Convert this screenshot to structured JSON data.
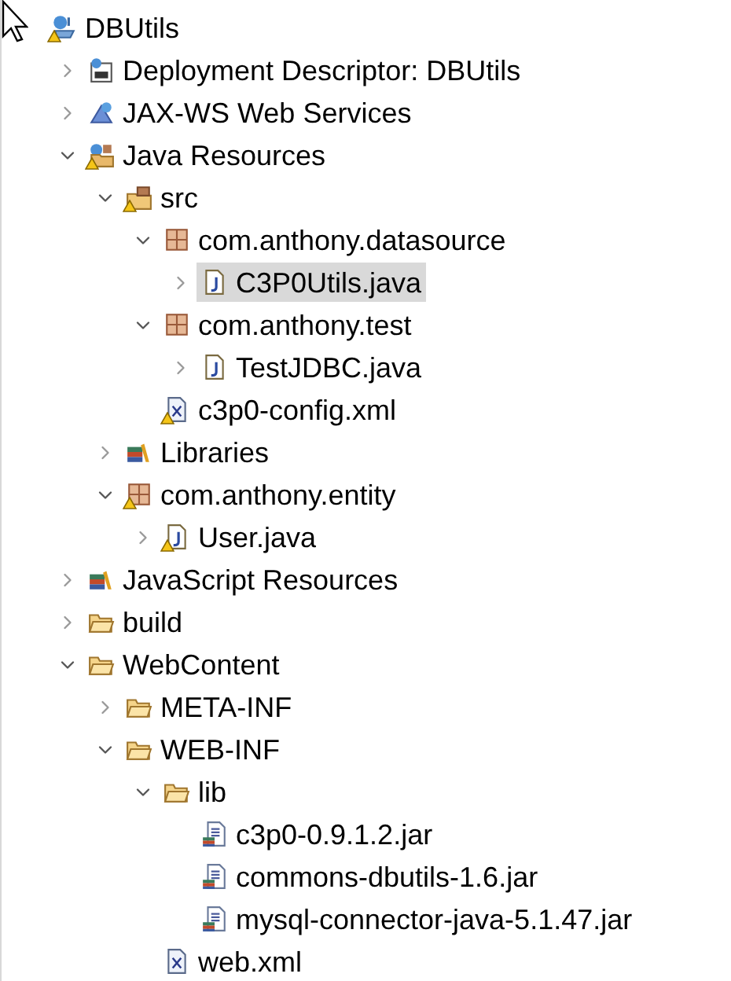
{
  "tree": [
    {
      "label": "DBUtils",
      "kind": "project",
      "warning": true,
      "selected": false,
      "children": [
        {
          "label": "Deployment Descriptor: DBUtils",
          "kind": "descriptor",
          "warning": false,
          "selected": false,
          "expanded": false
        },
        {
          "label": "JAX-WS Web Services",
          "kind": "webservices",
          "warning": false,
          "selected": false,
          "expanded": false
        },
        {
          "label": "Java Resources",
          "kind": "javaresources",
          "warning": true,
          "selected": false,
          "expanded": true,
          "children": [
            {
              "label": "src",
              "kind": "sourcefolder",
              "warning": true,
              "selected": false,
              "expanded": true,
              "children": [
                {
                  "label": "com.anthony.datasource",
                  "kind": "package",
                  "warning": false,
                  "selected": false,
                  "expanded": true,
                  "children": [
                    {
                      "label": "C3P0Utils.java",
                      "kind": "javafile",
                      "warning": false,
                      "selected": true,
                      "expanded": false
                    }
                  ]
                },
                {
                  "label": "com.anthony.test",
                  "kind": "package",
                  "warning": false,
                  "selected": false,
                  "expanded": true,
                  "children": [
                    {
                      "label": "TestJDBC.java",
                      "kind": "javafile",
                      "warning": false,
                      "selected": false,
                      "expanded": false
                    }
                  ]
                },
                {
                  "label": "c3p0-config.xml",
                  "kind": "xmlfile",
                  "warning": true,
                  "selected": false
                }
              ]
            },
            {
              "label": "Libraries",
              "kind": "library",
              "warning": false,
              "selected": false,
              "expanded": false
            },
            {
              "label": "com.anthony.entity",
              "kind": "package",
              "warning": true,
              "selected": false,
              "expanded": true,
              "children": [
                {
                  "label": "User.java",
                  "kind": "javafile",
                  "warning": true,
                  "selected": false,
                  "expanded": false
                }
              ]
            }
          ]
        },
        {
          "label": "JavaScript Resources",
          "kind": "library",
          "warning": false,
          "selected": false,
          "expanded": false
        },
        {
          "label": "build",
          "kind": "folder",
          "warning": false,
          "selected": false,
          "expanded": false
        },
        {
          "label": "WebContent",
          "kind": "folder",
          "warning": false,
          "selected": false,
          "expanded": true,
          "children": [
            {
              "label": "META-INF",
              "kind": "folder",
              "warning": false,
              "selected": false,
              "expanded": false
            },
            {
              "label": "WEB-INF",
              "kind": "folder",
              "warning": false,
              "selected": false,
              "expanded": true,
              "children": [
                {
                  "label": "lib",
                  "kind": "folder",
                  "warning": false,
                  "selected": false,
                  "expanded": true,
                  "children": [
                    {
                      "label": "c3p0-0.9.1.2.jar",
                      "kind": "jar",
                      "warning": false,
                      "selected": false
                    },
                    {
                      "label": "commons-dbutils-1.6.jar",
                      "kind": "jar",
                      "warning": false,
                      "selected": false
                    },
                    {
                      "label": "mysql-connector-java-5.1.47.jar",
                      "kind": "jar",
                      "warning": false,
                      "selected": false
                    }
                  ]
                },
                {
                  "label": "web.xml",
                  "kind": "xmlfile",
                  "warning": false,
                  "selected": false
                }
              ]
            }
          ]
        }
      ]
    }
  ]
}
